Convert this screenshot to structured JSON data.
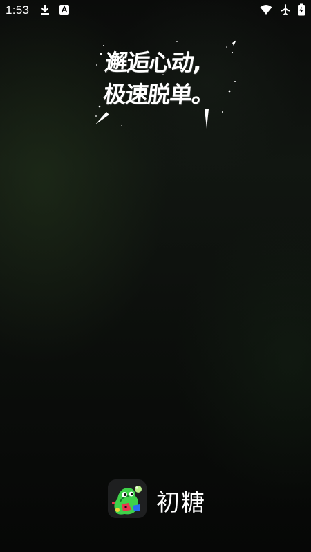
{
  "status_bar": {
    "time": "1:53",
    "icons": [
      "download-icon",
      "a-notification-icon",
      "wifi-icon",
      "airplane-icon",
      "battery-charging-icon"
    ]
  },
  "splash": {
    "slogan_line_1": "邂逅心动,",
    "slogan_line_2": "极速脱单。"
  },
  "brand": {
    "app_name": "初糖",
    "icon": "app-logo-icon"
  },
  "colors": {
    "background": "#0b0d0b",
    "text": "#ffffff",
    "icon_tile": "#1e1f20",
    "logo_green": "#3fd14a"
  }
}
